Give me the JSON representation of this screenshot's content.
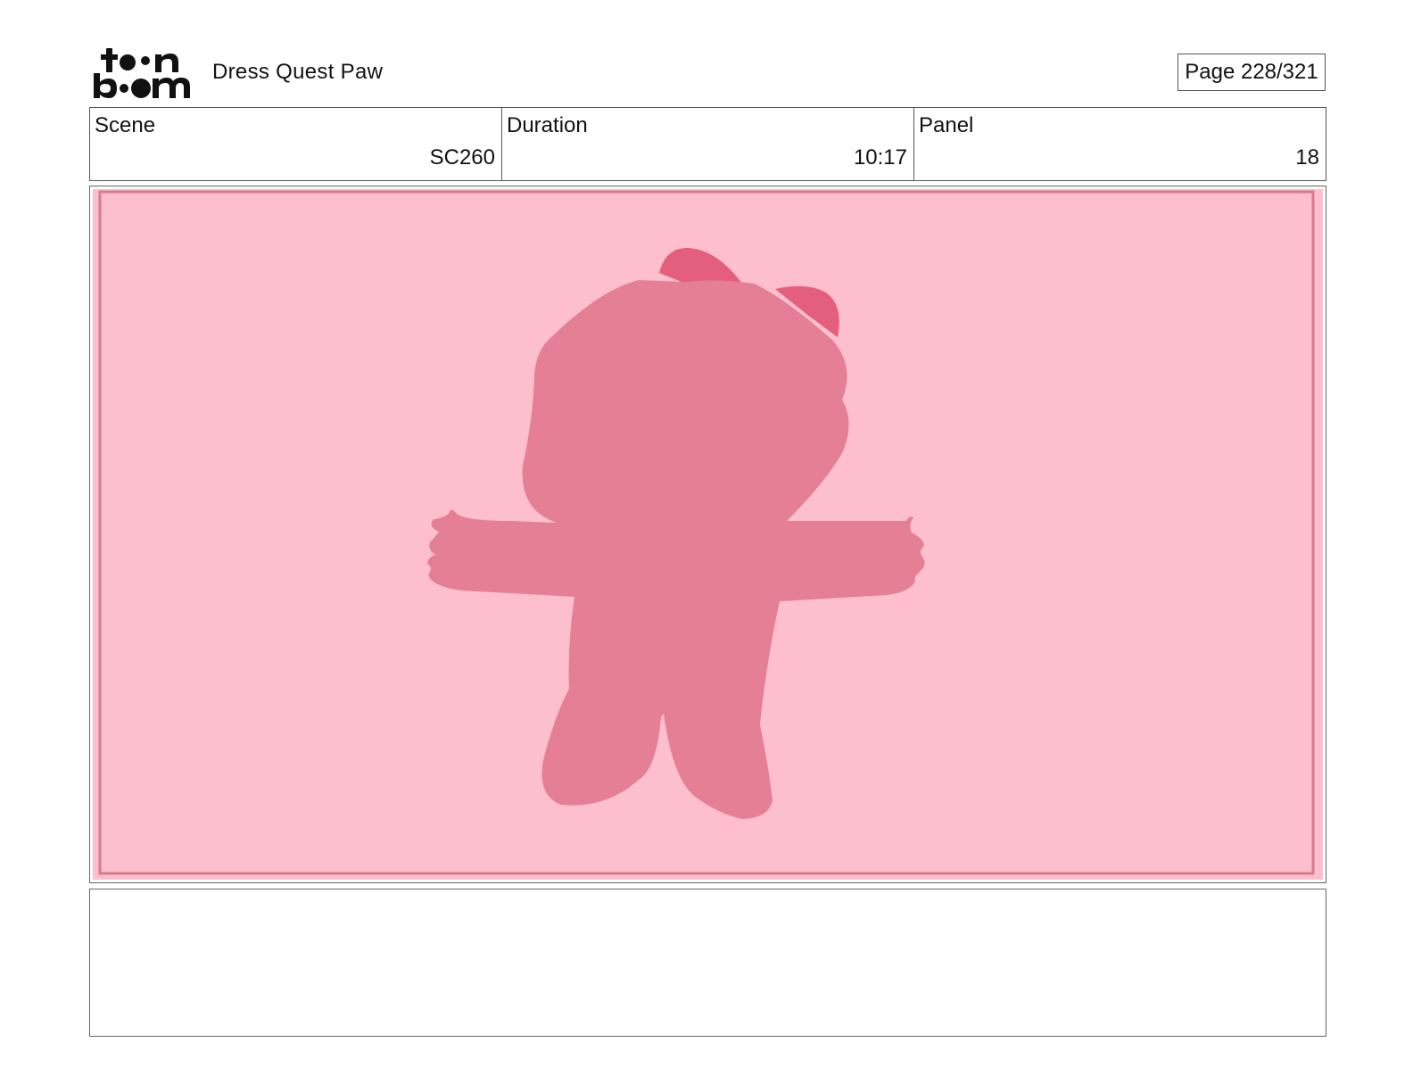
{
  "header": {
    "logo_text": "toon boom",
    "project_title": "Dress Quest Paw",
    "page_label": "Page 228/321"
  },
  "info": {
    "scene": {
      "label": "Scene",
      "value": "SC260"
    },
    "duration": {
      "label": "Duration",
      "value": "10:17"
    },
    "panel": {
      "label": "Panel",
      "value": "18"
    }
  },
  "panel_image": {
    "background_color": "#fdbfcd",
    "inner_border_color": "#d87a8c",
    "character_color": "#e57f96",
    "bow_color": "#e45f7e"
  },
  "notes": {
    "text": ""
  }
}
